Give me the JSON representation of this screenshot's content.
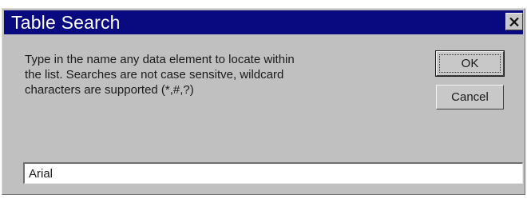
{
  "window": {
    "title": "Table Search",
    "close_icon": "close-icon"
  },
  "instructions": {
    "line1": "Type in the name any data element to locate within",
    "line2": "the list. Searches are not case sensitve, wildcard",
    "line3": "characters are supported (*,#,?)"
  },
  "buttons": {
    "ok_label": "OK",
    "cancel_label": "Cancel"
  },
  "search": {
    "value": "Arial"
  },
  "colors": {
    "titlebar": "#0a0a80",
    "dialog_bg": "#c0c0c0",
    "title_text": "#ffffff"
  }
}
